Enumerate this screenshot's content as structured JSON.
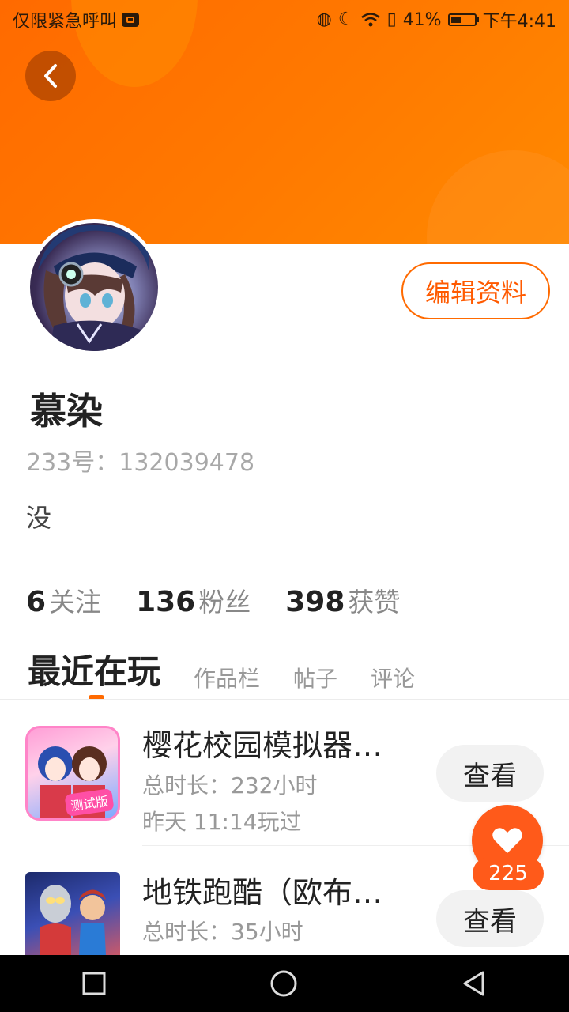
{
  "status_bar": {
    "left_text": "仅限紧急呼叫",
    "battery": "41%",
    "time": "下午4:41"
  },
  "profile": {
    "username": "慕染",
    "uid": "233号：132039478",
    "bio": "没",
    "edit_label": "编辑资料"
  },
  "stats": [
    {
      "value": "6",
      "label": "关注"
    },
    {
      "value": "136",
      "label": "粉丝"
    },
    {
      "value": "398",
      "label": "获赞"
    }
  ],
  "tabs": [
    "最近在玩",
    "作品栏",
    "帖子",
    "评论"
  ],
  "games": [
    {
      "title": "樱花校园模拟器…",
      "duration": "总时长：232小时",
      "last_played": "昨天 11:14玩过",
      "badge": "测试版",
      "action": "查看"
    },
    {
      "title": "地铁跑酷（欧布…",
      "duration": "总时长：35小时",
      "action": "查看"
    }
  ],
  "like": {
    "count": "225"
  },
  "colors": {
    "accent": "#ff6a00",
    "header": "#ff7a00"
  }
}
